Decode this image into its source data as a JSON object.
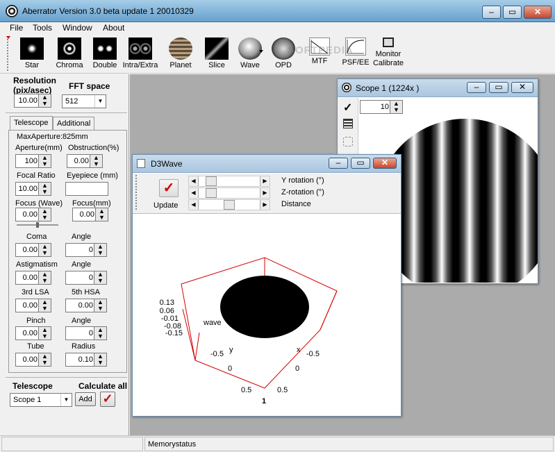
{
  "window": {
    "title": "Aberrator Version 3.0 beta update 1 20010329",
    "min": "‒",
    "max": "▭",
    "close": "✕"
  },
  "menu": [
    "File",
    "Tools",
    "Window",
    "About"
  ],
  "toolbar": [
    {
      "label": "Star",
      "icon": "star-icon"
    },
    {
      "label": "Chroma",
      "icon": "chroma-icon"
    },
    {
      "label": "Double",
      "icon": "double-star-icon"
    },
    {
      "label": "Intra/Extra",
      "icon": "intra-extra-icon"
    },
    {
      "label": "Planet",
      "icon": "planet-icon"
    },
    {
      "label": "Slice",
      "icon": "slice-icon"
    },
    {
      "label": "Wave",
      "icon": "wave-icon"
    },
    {
      "label": "OPD",
      "icon": "opd-icon"
    },
    {
      "label": "MTF",
      "icon": "mtf-icon"
    },
    {
      "label": "PSF/EE",
      "icon": "psf-ee-icon"
    },
    {
      "label": "Monitor",
      "label2": "Calibrate",
      "icon": "monitor-icon"
    }
  ],
  "left": {
    "resolution_label1": "Resolution",
    "resolution_label2": "(pix/asec)",
    "resolution_value": "10.00",
    "fft_label": "FFT space",
    "fft_value": "512",
    "tabs": [
      "Telescope",
      "Additional"
    ],
    "max_aperture": "MaxAperture:825mm",
    "fields": [
      {
        "label": "Aperture(mm)",
        "value": "100"
      },
      {
        "label": "Obstruction(%)",
        "value": "0.00"
      },
      {
        "label": "Focal Ratio",
        "value": "10.00"
      },
      {
        "label": "Eyepiece (mm)",
        "value": ""
      },
      {
        "label": "Focus (Wave)",
        "value": "0.00"
      },
      {
        "label": "Focus(mm)",
        "value": "0.00"
      },
      {
        "label": "Coma",
        "value": "0.00"
      },
      {
        "label": "Angle",
        "value": "0"
      },
      {
        "label": "Astigmatism",
        "value": "0.00"
      },
      {
        "label": "Angle",
        "value": "0"
      },
      {
        "label": "3rd LSA",
        "value": "0.00"
      },
      {
        "label": "5th HSA",
        "value": "0.00"
      },
      {
        "label": "Pinch",
        "value": "0.00"
      },
      {
        "label": "Angle",
        "value": "0"
      },
      {
        "label": "Tube",
        "value": "0.00"
      },
      {
        "label": "Radius",
        "value": "0.10"
      }
    ],
    "telescope_label": "Telescope",
    "calculate_label": "Calculate all",
    "scope_value": "Scope 1",
    "add_label": "Add"
  },
  "scope_window": {
    "title": "Scope 1 (1224x )",
    "spin_value": "10"
  },
  "d3wave": {
    "title": "D3Wave",
    "update_label": "Update",
    "sliders": [
      "Y rotation (°)",
      "Z-rotation (°)",
      "Distance"
    ],
    "ticks_z": [
      "0.13",
      "0.06",
      "-0.01",
      "-0.08",
      "-0.15"
    ],
    "z_label": "wave",
    "y_label": "y",
    "x_label": "x",
    "ticks_y": [
      "-0.5",
      "0",
      "0.5"
    ],
    "ticks_x": [
      "-0.5",
      "0",
      "0.5"
    ],
    "bottom_tick": "1"
  },
  "status": {
    "memory": "Memorystatus"
  },
  "watermark": "SOFTPEDIA",
  "colors": {
    "accent_check": "#cc0000",
    "axes_box": "#d40000"
  }
}
